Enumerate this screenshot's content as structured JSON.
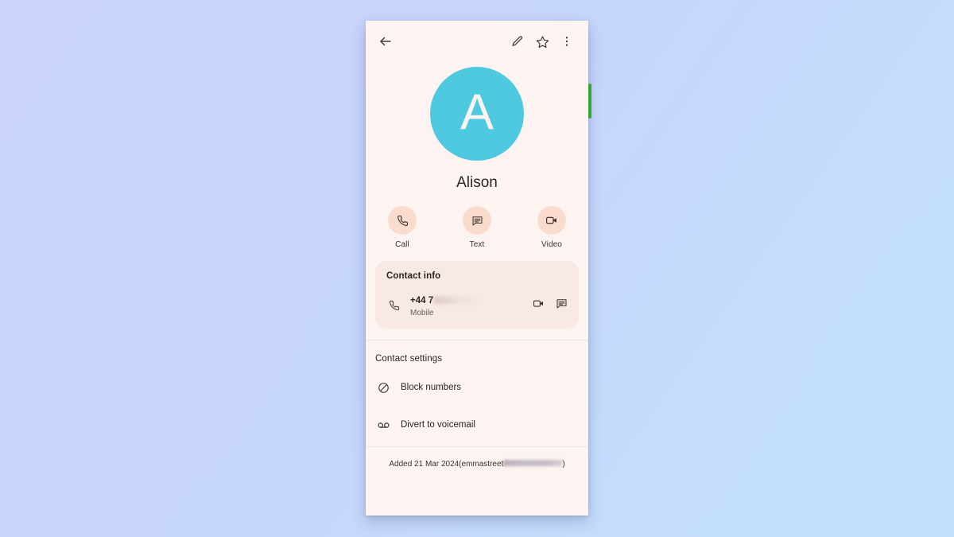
{
  "background": {
    "gradient_from": "#c9d3fc",
    "gradient_to": "#c2e0fd"
  },
  "device": {
    "screen_bg": "#fdf4f1",
    "side_indicator_color": "#35a633",
    "side_indicator_name": "volume-indicator"
  },
  "topbar": {
    "back_label": "Back",
    "edit_label": "Edit contact",
    "favorite_label": "Add to favourites",
    "more_label": "More options"
  },
  "profile": {
    "avatar_letter": "A",
    "avatar_color": "#4ec9e0",
    "name": "Alison"
  },
  "quick_actions": [
    {
      "icon": "phone-icon",
      "label": "Call"
    },
    {
      "icon": "message-icon",
      "label": "Text"
    },
    {
      "icon": "video-icon",
      "label": "Video"
    }
  ],
  "contact_info": {
    "title": "Contact info",
    "card_color": "#f8e9e5",
    "phone": {
      "number_visible": "+44 7",
      "number_redacted": true,
      "type": "Mobile",
      "video_action_label": "Video call",
      "message_action_label": "Send message"
    }
  },
  "contact_settings": {
    "title": "Contact settings",
    "items": [
      {
        "icon": "block-icon",
        "label": "Block numbers"
      },
      {
        "icon": "voicemail-icon",
        "label": "Divert to voicemail"
      }
    ]
  },
  "footer": {
    "added_text": "Added 21 Mar 2024(emmastreet",
    "account_redacted": true,
    "closing_paren": ")"
  }
}
